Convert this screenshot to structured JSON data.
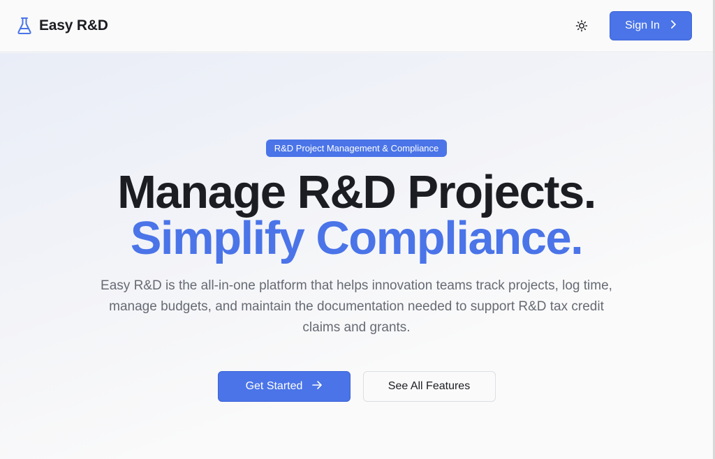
{
  "brand": {
    "name": "Easy R&D",
    "icon": "flask-icon",
    "icon_color": "#4a74e8"
  },
  "nav": {
    "theme_toggle_icon": "sun-icon",
    "signin_label": "Sign In",
    "signin_icon": "chevron-right-icon"
  },
  "hero": {
    "badge": "R&D Project Management & Compliance",
    "headline_line1": "Manage R&D Projects.",
    "headline_line2": "Simplify Compliance.",
    "subtitle": "Easy R&D is the all-in-one platform that helps innovation teams track projects, log time, manage budgets, and maintain the documentation needed to support R&D tax credit claims and grants.",
    "primary_cta": "Get Started",
    "primary_cta_icon": "arrow-right-icon",
    "secondary_cta": "See All Features"
  },
  "colors": {
    "accent": "#4a74e8",
    "text_dark": "#1c1d22",
    "text_muted": "#666a73"
  }
}
